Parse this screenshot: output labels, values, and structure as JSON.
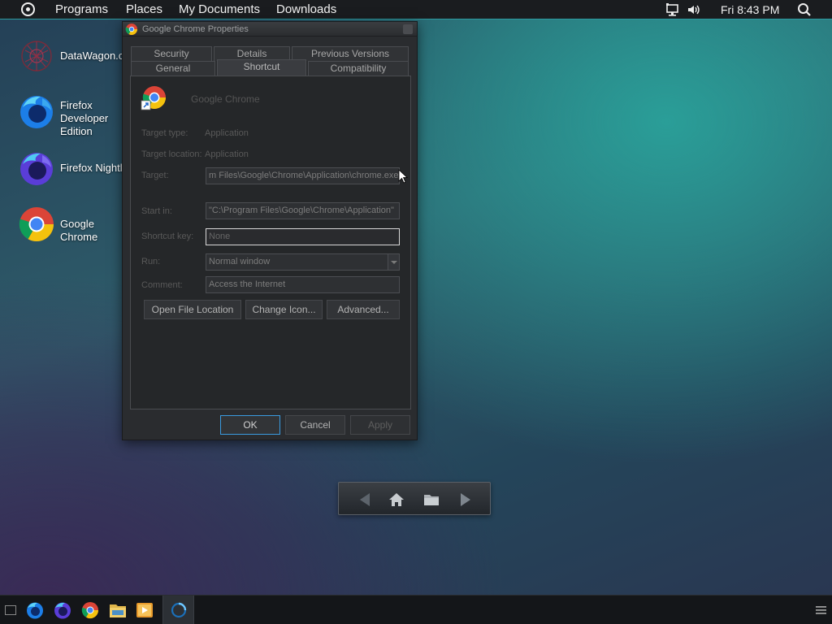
{
  "top_panel": {
    "menu": [
      "Programs",
      "Places",
      "My Documents",
      "Downloads"
    ],
    "clock": "Fri 8:43 PM",
    "icons": [
      "app-menu-icon",
      "network-icon",
      "volume-icon",
      "search-icon"
    ]
  },
  "desktop": {
    "icons": [
      {
        "label": "DataWagon.cc",
        "icon": "datawagon-icon"
      },
      {
        "label": "Firefox Developer Edition",
        "icon": "firefox-developer-icon"
      },
      {
        "label": "Firefox Nightly",
        "icon": "firefox-nightly-icon"
      },
      {
        "label": "Google Chrome",
        "icon": "chrome-icon"
      }
    ]
  },
  "dialog": {
    "title": "Google Chrome Properties",
    "tabs_back": [
      "Security",
      "Details",
      "Previous Versions"
    ],
    "tabs_front": [
      "General",
      "Shortcut",
      "Compatibility"
    ],
    "active_tab": "Shortcut",
    "app_name": "Google Chrome",
    "target_type_label": "Target type:",
    "target_type_value": "Application",
    "target_location_label": "Target location:",
    "target_location_value": "Application",
    "target_label": "Target:",
    "target_value": "m Files\\Google\\Chrome\\Application\\chrome.exe\"",
    "start_in_label": "Start in:",
    "start_in_value": "\"C:\\Program Files\\Google\\Chrome\\Application\"",
    "shortcut_key_label": "Shortcut key:",
    "shortcut_key_value": "None",
    "run_label": "Run:",
    "run_value": "Normal window",
    "comment_label": "Comment:",
    "comment_value": "Access the Internet",
    "buttons": {
      "open_file_location": "Open File Location",
      "change_icon": "Change Icon...",
      "advanced": "Advanced..."
    },
    "footer": {
      "ok": "OK",
      "cancel": "Cancel",
      "apply": "Apply"
    }
  },
  "float_nav": {
    "icons": [
      "back-arrow-icon",
      "home-icon",
      "folder-icon",
      "forward-arrow-icon"
    ]
  },
  "taskbar": {
    "items": [
      "show-desktop-icon",
      "firefox-developer-icon",
      "firefox-nightly-icon",
      "chrome-icon",
      "file-manager-icon",
      "media-player-icon",
      "loading-spinner-icon",
      "taskbar-menu-icon"
    ]
  },
  "colors": {
    "accent": "#2c9aa0",
    "focus_blue": "#3a9be0",
    "panel_bg": "#1a1c1f",
    "dialog_bg": "#2a2c2f"
  }
}
